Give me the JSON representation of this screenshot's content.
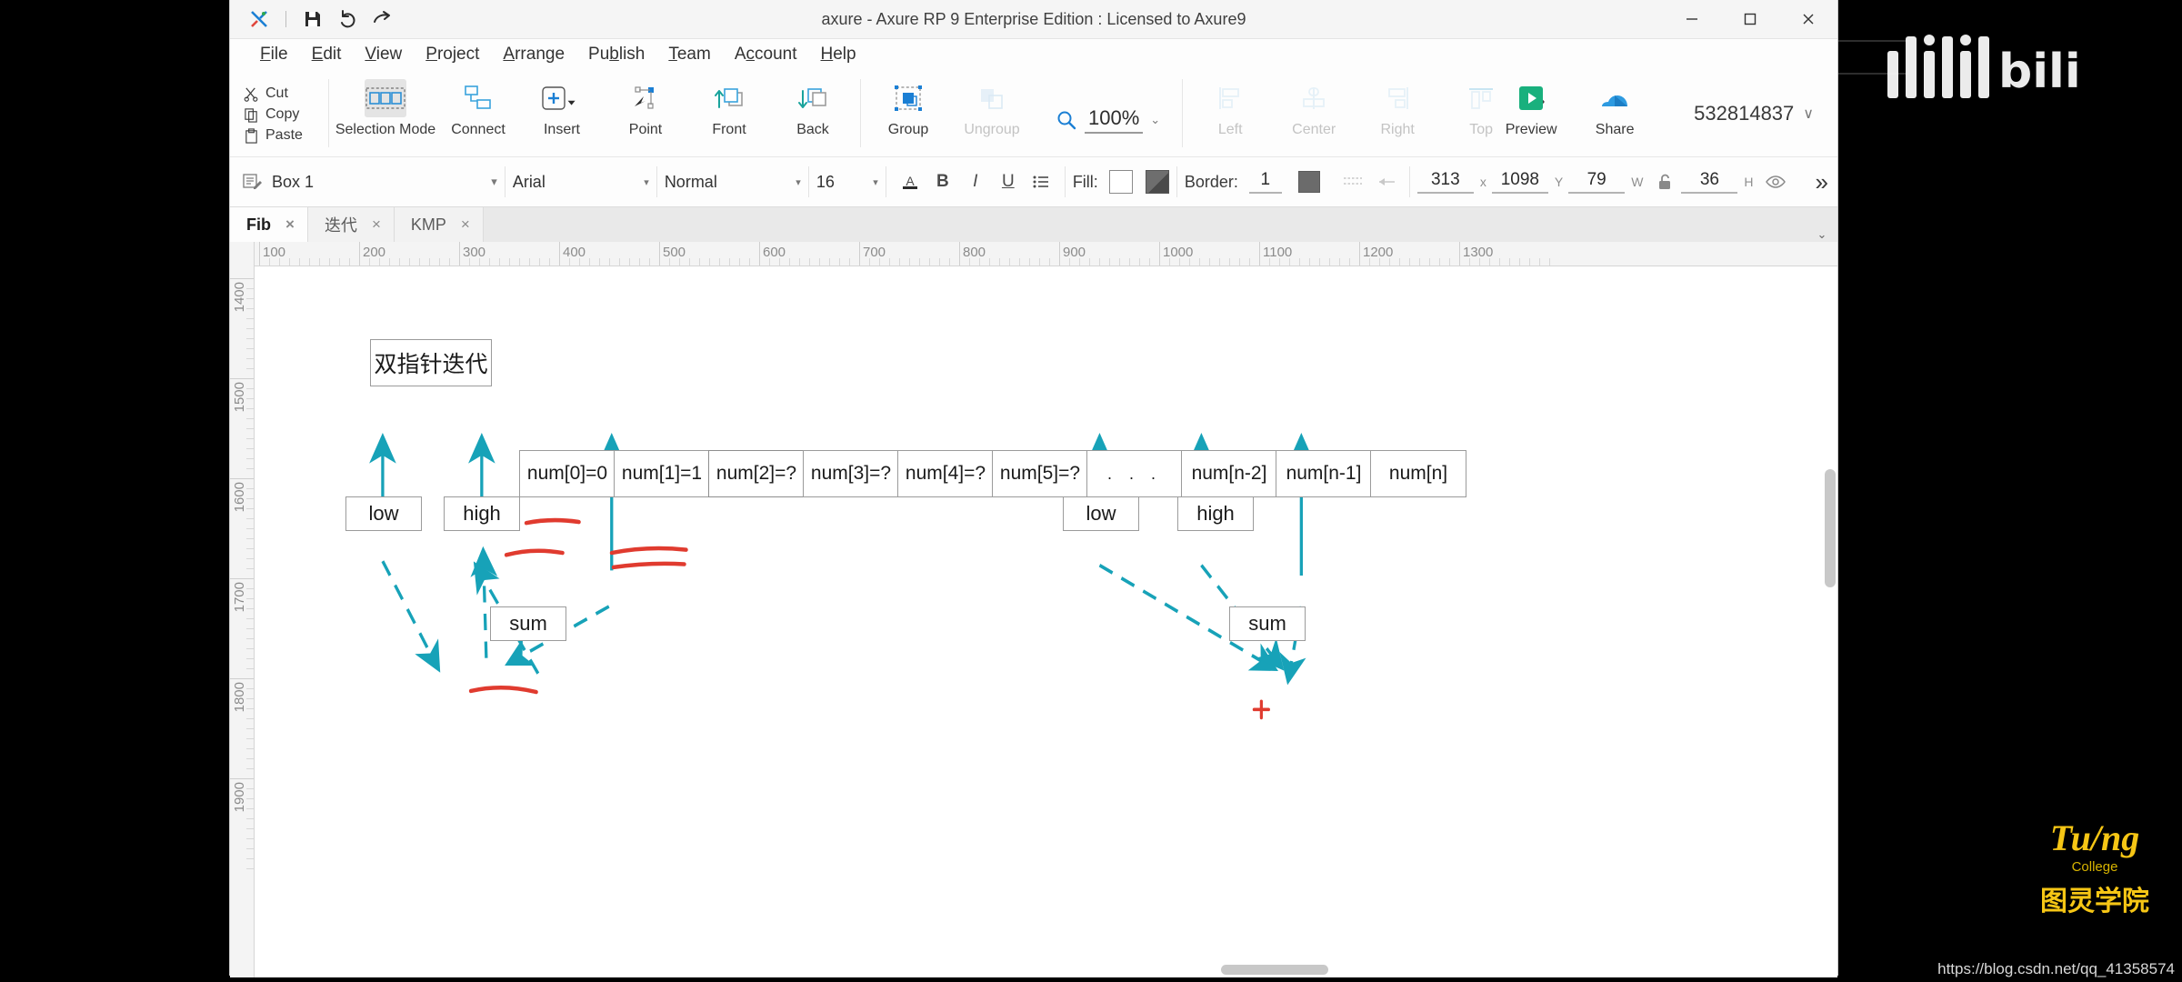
{
  "window": {
    "title": "axure - Axure RP 9 Enterprise Edition : Licensed to Axure9",
    "minimize": "—",
    "maximize": "□",
    "close": "✕"
  },
  "quick_access": {
    "app_icon": "axure-logo-icon",
    "save": "save-icon",
    "undo": "undo-icon",
    "redo": "redo-icon"
  },
  "menubar": [
    {
      "label": "File",
      "accel": "F"
    },
    {
      "label": "Edit",
      "accel": "E"
    },
    {
      "label": "View",
      "accel": "V"
    },
    {
      "label": "Project",
      "accel": "P"
    },
    {
      "label": "Arrange",
      "accel": "A"
    },
    {
      "label": "Publish",
      "accel": "b"
    },
    {
      "label": "Team",
      "accel": "T"
    },
    {
      "label": "Account",
      "accel": "c"
    },
    {
      "label": "Help",
      "accel": "H"
    }
  ],
  "clipboard": [
    {
      "label": "Cut",
      "icon": "scissors-icon"
    },
    {
      "label": "Copy",
      "icon": "copy-icon"
    },
    {
      "label": "Paste",
      "icon": "paste-icon"
    }
  ],
  "ribbon": [
    {
      "label": "Selection Mode",
      "icon": "selection-mode-icon",
      "disabled": false,
      "selected": true
    },
    {
      "label": "Connect",
      "icon": "connect-icon",
      "disabled": false,
      "selected": false
    },
    {
      "label": "Insert",
      "icon": "insert-plus-icon",
      "disabled": false,
      "selected": false,
      "dropdown": true
    },
    {
      "label": "Point",
      "icon": "point-icon",
      "disabled": false,
      "selected": false
    },
    {
      "label": "Front",
      "icon": "bring-front-icon",
      "disabled": false,
      "selected": false
    },
    {
      "label": "Back",
      "icon": "send-back-icon",
      "disabled": false,
      "selected": false
    },
    {
      "label": "Group",
      "icon": "group-icon",
      "disabled": false,
      "selected": false
    },
    {
      "label": "Ungroup",
      "icon": "ungroup-icon",
      "disabled": true,
      "selected": false
    }
  ],
  "zoom": {
    "icon": "magnifier-icon",
    "value": "100%",
    "chevron": "⌄"
  },
  "align": [
    {
      "label": "Left",
      "icon": "align-left-icon",
      "disabled": true
    },
    {
      "label": "Center",
      "icon": "align-center-icon",
      "disabled": true
    },
    {
      "label": "Right",
      "icon": "align-right-icon",
      "disabled": true
    },
    {
      "label": "Top",
      "icon": "align-top-icon",
      "disabled": true
    }
  ],
  "ribbon_overflow": "»",
  "publish": [
    {
      "label": "Preview",
      "icon": "preview-play-icon"
    },
    {
      "label": "Share",
      "icon": "share-cloud-icon"
    }
  ],
  "account": {
    "id": "532814837",
    "chevron": "∨"
  },
  "format_bar": {
    "widget_icon": "widget-notes-icon",
    "widget_name": "Box 1",
    "font_family": "Arial",
    "font_style": "Normal",
    "font_size": "16",
    "font_color_icon": "font-color-A-icon",
    "bold": "B",
    "italic": "I",
    "underline": "U",
    "list": "bullet-list-icon",
    "fill_label": "Fill:",
    "fill_swatch": "fill-none-swatch",
    "fill_gradient": "fill-gradient-swatch",
    "border_label": "Border:",
    "border_width": "1",
    "border_color": "border-color-swatch",
    "border_style_icon": "line-style-dotted-icon",
    "border_arrow_icon": "line-arrow-icon",
    "x_value": "313",
    "x_unit": "x",
    "y_value": "1098",
    "y_unit": "Y",
    "w_value": "79",
    "w_unit": "W",
    "lock_icon": "lock-open-icon",
    "h_value": "36",
    "h_unit": "H",
    "visibility_icon": "eye-icon",
    "overflow": "»"
  },
  "tabs": [
    {
      "label": "Fib",
      "active": true,
      "close": "×"
    },
    {
      "label": "迭代",
      "active": false,
      "close": "×"
    },
    {
      "label": "KMP",
      "active": false,
      "close": "×"
    }
  ],
  "tabs_overflow": "⌄",
  "rulers": {
    "horizontal": [
      "100",
      "200",
      "300",
      "400",
      "500",
      "600",
      "700",
      "800",
      "900",
      "1000",
      "1100",
      "1200",
      "1300"
    ],
    "vertical": [
      "1400",
      "1500",
      "1600",
      "1700",
      "1800",
      "1900"
    ],
    "origin_icon": "ruler-origin-icon"
  },
  "diagram": {
    "title_box": "双指针迭代",
    "cells": [
      "num[0]=0",
      "num[1]=1",
      "num[2]=?",
      "num[3]=?",
      "num[4]=?",
      "num[5]=?",
      ". . .",
      "num[n-2]",
      "num[n-1]",
      "num[n]"
    ],
    "left_group": {
      "low": "low",
      "high": "high",
      "sum": "sum"
    },
    "right_group": {
      "low": "low",
      "high": "high",
      "sum": "sum"
    },
    "arrow_color": "#17a2b8",
    "underline_color": "#e03b2f",
    "box_border_color": "#9b9b9b"
  },
  "watermarks": {
    "bilibili": "bilibili",
    "turing_top": "Tu/ng",
    "turing_sub": "College",
    "turing_bottom": "图灵学院",
    "blog_url": "https://blog.csdn.net/qq_41358574"
  }
}
